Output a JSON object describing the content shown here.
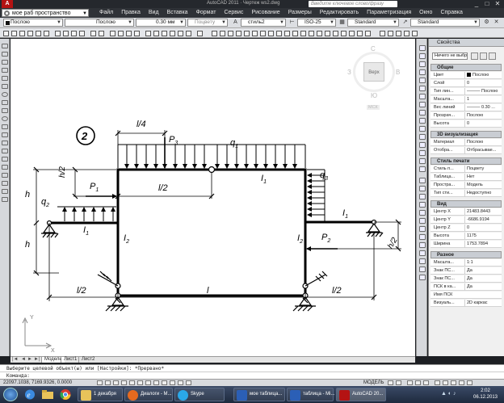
{
  "window": {
    "logo": "A",
    "title": "AutoCAD 2011 · Чертеж ws2.dwg",
    "search_placeholder": "Введите ключевое слово/фразу",
    "minimize": "_",
    "maximize": "□",
    "close": "✕"
  },
  "menubar": {
    "workspace": "мое раб пространство",
    "items": [
      "Файл",
      "Правка",
      "Вид",
      "Вставка",
      "Формат",
      "Сервис",
      "Рисование",
      "Размеры",
      "Редактировать",
      "Параметризация",
      "Окно",
      "Справка"
    ]
  },
  "toolbar1": {
    "color": "Послою",
    "linetype": "Послою",
    "lineweight": "0.30 мм",
    "plotstyle": "Поцвету",
    "textstyle": "стиль2",
    "dimstyle": "ISO-25",
    "tablestyle": "Standard",
    "mleaderstyle": "Standard"
  },
  "canvas": {
    "viewcube": {
      "north": "С",
      "south": "Ю",
      "west": "З",
      "east": "В",
      "top": "Верх",
      "wcs": "МСК"
    },
    "figure_number": "2",
    "labels": {
      "l4": "l/4",
      "p3": "P",
      "p3_sub": "3",
      "q1": "q",
      "q1_sub": "1",
      "q3": "q",
      "q3_sub": "3",
      "p1": "P",
      "p1_sub": "1",
      "q2": "q",
      "q2_sub": "2",
      "h2_left": "h/2",
      "l2_mid": "l/2",
      "h_left_top": "h",
      "h_left_bot": "h",
      "i1_top": "I",
      "i1_top_sub": "1",
      "i1_left": "I",
      "i1_left_sub": "1",
      "i2_left": "I",
      "i2_left_sub": "2",
      "i1_right": "I",
      "i1_right_sub": "1",
      "i2_right": "I",
      "i2_right_sub": "2",
      "p2": "P",
      "p2_sub": "2",
      "h2_right": "h/2",
      "l2_bot_left": "l/2",
      "l_bot": "l",
      "l2_bot_right": "l/2"
    },
    "ucs": {
      "x": "X",
      "y": "Y"
    }
  },
  "tabs": {
    "model": "Модель",
    "layout1": "Лист1",
    "layout2": "Лист2"
  },
  "properties": {
    "header": "Свойства",
    "selection": "Ничего не выбрано",
    "sections": [
      {
        "title": "Общие",
        "rows": [
          {
            "k": "Цвет",
            "v": "Послою",
            "swatch": true
          },
          {
            "k": "Слой",
            "v": "0"
          },
          {
            "k": "Тип лин...",
            "v": "——— Послою"
          },
          {
            "k": "Масшта...",
            "v": "1"
          },
          {
            "k": "Вес линий",
            "v": "——— 0.30 ..."
          },
          {
            "k": "Прозрач...",
            "v": "Послою"
          },
          {
            "k": "Высота",
            "v": "0"
          }
        ]
      },
      {
        "title": "3D визуализация",
        "rows": [
          {
            "k": "Материал",
            "v": "Послою"
          },
          {
            "k": "Отобра...",
            "v": "Отбрасывае..."
          }
        ]
      },
      {
        "title": "Стиль печати",
        "rows": [
          {
            "k": "Стиль п...",
            "v": "Поцвету"
          },
          {
            "k": "Таблица...",
            "v": "Нет"
          },
          {
            "k": "Простра...",
            "v": "Модель"
          },
          {
            "k": "Тип сти...",
            "v": "Недоступно"
          }
        ]
      },
      {
        "title": "Вид",
        "rows": [
          {
            "k": "Центр X",
            "v": "21483.8443"
          },
          {
            "k": "Центр Y",
            "v": "-6686.9194"
          },
          {
            "k": "Центр Z",
            "v": "0"
          },
          {
            "k": "Высота",
            "v": "1175"
          },
          {
            "k": "Ширина",
            "v": "1753.7894"
          }
        ]
      },
      {
        "title": "Разное",
        "rows": [
          {
            "k": "Масшта...",
            "v": "1:1"
          },
          {
            "k": "Знак ПС...",
            "v": "Да"
          },
          {
            "k": "Знак ПС...",
            "v": "Да"
          },
          {
            "k": "ПСК в ка...",
            "v": "Да"
          },
          {
            "k": "Имя ПСК",
            "v": ""
          },
          {
            "k": "Визуаль...",
            "v": "2D каркас"
          }
        ]
      }
    ]
  },
  "command": {
    "history": "Выберите целевой объект(ы) или [Настройки]: *Прервано*",
    "prompt": "Команда:"
  },
  "status": {
    "coords": "22097.1038, 7169.9326, 0.0000",
    "space": "МОДЕЛЬ"
  },
  "taskbar": {
    "tasks": [
      "1 декабря",
      "Диалоги - М...",
      "Skype",
      "мое таблица...",
      "таблица - Mi...",
      "AutoCAD 20..."
    ],
    "time": "2:02",
    "date": "06.12.2013"
  },
  "colors": {
    "accent_red": "#b41313",
    "titlebar": "#25282d",
    "menubar": "#2f3237"
  }
}
